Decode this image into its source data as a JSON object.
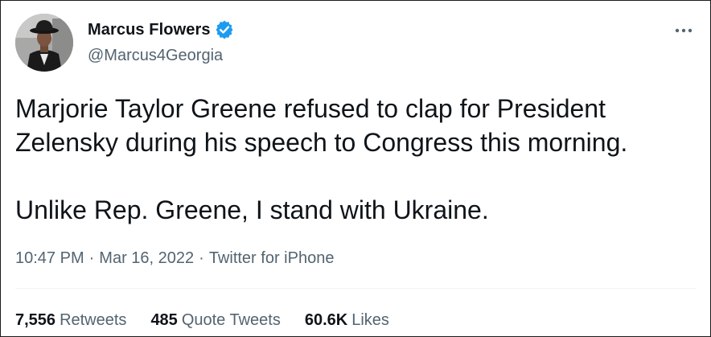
{
  "author": {
    "display_name": "Marcus Flowers",
    "handle": "@Marcus4Georgia",
    "verified": true,
    "avatar_icon": "profile-photo"
  },
  "menu": {
    "more_icon": "more-horizontal-icon"
  },
  "tweet": {
    "text_lines": [
      "Marjorie Taylor Greene refused to clap for President",
      "Zelensky during his speech to Congress this morning."
    ],
    "text_para2": "Unlike Rep. Greene, I stand with Ukraine."
  },
  "meta": {
    "time": "10:47 PM",
    "separator": "·",
    "date": "Mar 16, 2022",
    "source": "Twitter for iPhone"
  },
  "stats": {
    "retweets_count": "7,556",
    "retweets_label": "Retweets",
    "quotes_count": "485",
    "quotes_label": "Quote Tweets",
    "likes_count": "60.6K",
    "likes_label": "Likes"
  },
  "colors": {
    "text_primary": "#0f1419",
    "text_secondary": "#536471",
    "verified_blue": "#1d9bf0",
    "divider": "#eff3f4"
  }
}
